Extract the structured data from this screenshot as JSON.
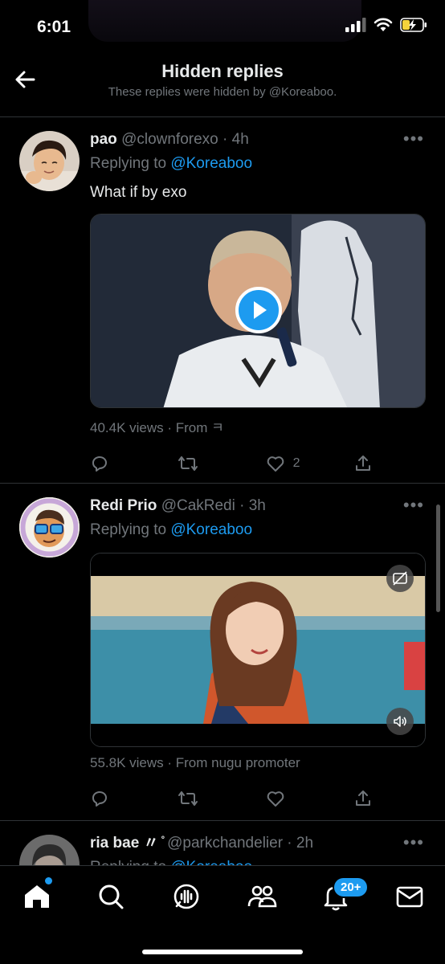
{
  "status": {
    "time": "6:01"
  },
  "header": {
    "title": "Hidden replies",
    "subtitle": "These replies were hidden by @Koreaboo."
  },
  "tweets": [
    {
      "name": "pao",
      "handle": "@clownforexo",
      "sep": " · ",
      "time": "4h",
      "replying_prefix": "Replying to ",
      "replying_to": "@Koreaboo",
      "text": "What if by exo",
      "views": "40.4K views · From ㅋ",
      "reply_count": "",
      "retweet_count": "",
      "like_count": "2"
    },
    {
      "name": "Redi Prio",
      "handle": "@CakRedi",
      "sep": " · ",
      "time": "3h",
      "replying_prefix": "Replying to ",
      "replying_to": "@Koreaboo",
      "views": "55.8K views · From nugu promoter"
    },
    {
      "name": "ria bae",
      "name_suffix": "〃 ̊",
      "handle": "@parkchandelier",
      "sep": " · ",
      "time": "2h",
      "replying_prefix": "Replying to ",
      "replying_to": "@Koreaboo"
    }
  ],
  "tabbar": {
    "notifications_badge": "20+"
  },
  "colors": {
    "accent": "#1d9bf0",
    "background": "#000000",
    "muted": "#71767b"
  }
}
